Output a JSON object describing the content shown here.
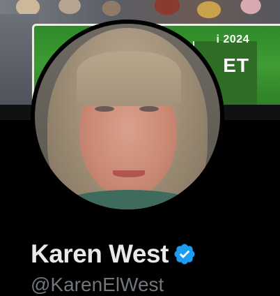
{
  "banner": {
    "sign_year": "i 2024",
    "sign_word": "ET"
  },
  "profile": {
    "display_name": "Karen West",
    "handle": "@KarenElWest",
    "verified_icon": "verified-badge-icon",
    "accent_color": "#1d9bf0"
  }
}
